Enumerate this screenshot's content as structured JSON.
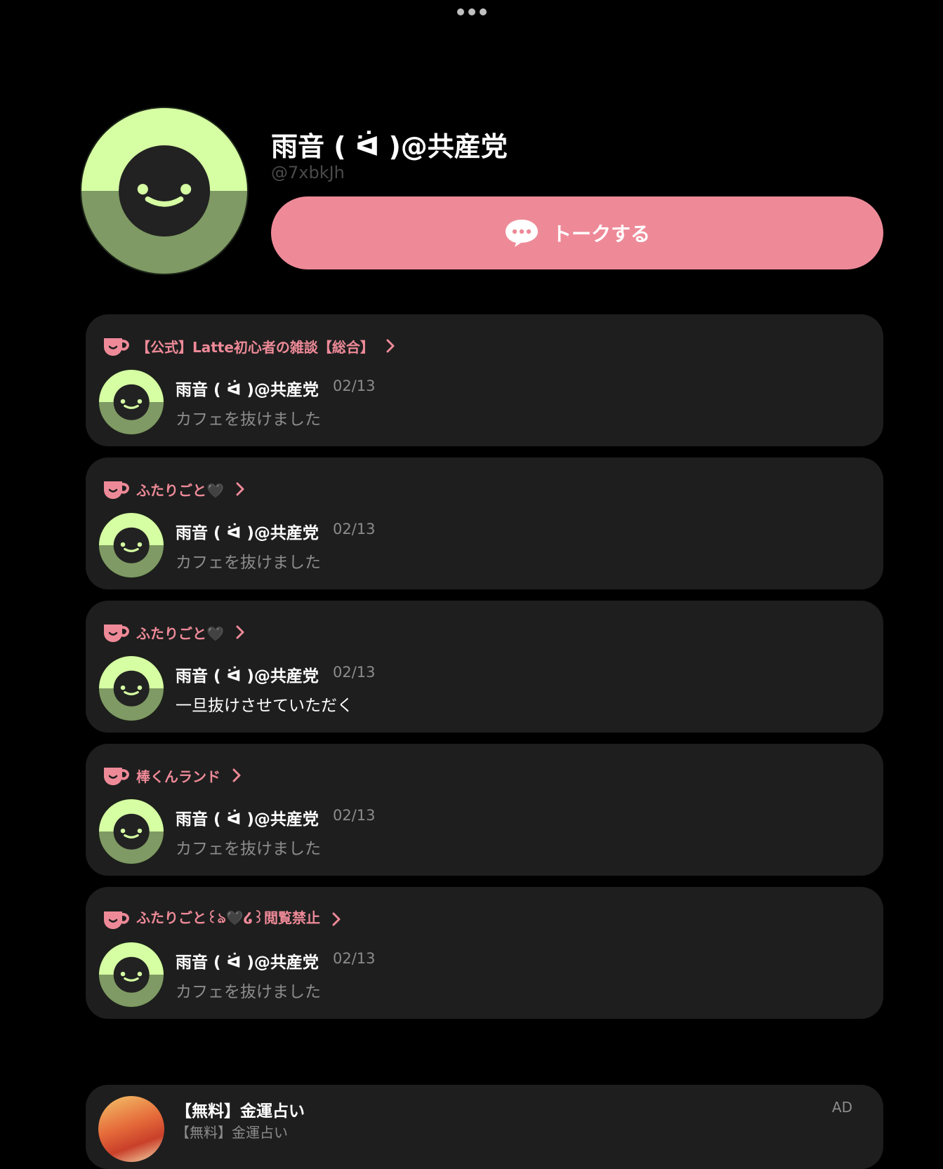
{
  "profile": {
    "name": "雨音 ( ᐛ )@共産党",
    "handle": "@7xbkJh",
    "talk_button_label": "トークする"
  },
  "posts": [
    {
      "cafe": "【公式】Latte初心者の雑談【総合】",
      "author": "雨音 ( ᐛ )@共産党",
      "date": "02/13",
      "message": "カフェを抜けました",
      "emphasis": false
    },
    {
      "cafe": "ふたりごと🖤",
      "author": "雨音 ( ᐛ )@共産党",
      "date": "02/13",
      "message": "カフェを抜けました",
      "emphasis": false
    },
    {
      "cafe": "ふたりごと🖤",
      "author": "雨音 ( ᐛ )@共産党",
      "date": "02/13",
      "message": "一旦抜けさせていただく",
      "emphasis": true
    },
    {
      "cafe": "棒くんランド",
      "author": "雨音 ( ᐛ )@共産党",
      "date": "02/13",
      "message": "カフェを抜けました",
      "emphasis": false
    },
    {
      "cafe": "ふたりごと꒰ঌ🖤໒꒱閲覧禁止",
      "author": "雨音 ( ᐛ )@共産党",
      "date": "02/13",
      "message": "カフェを抜けました",
      "emphasis": false
    }
  ],
  "ad": {
    "title": "【無料】金運占い",
    "subtitle": "【無料】金運占い",
    "label": "AD"
  },
  "colors": {
    "accent": "#ee8a98",
    "card_bg": "#1e1e1e",
    "avatar_light": "#d6ffa3",
    "avatar_dark": "#7f9a64"
  }
}
